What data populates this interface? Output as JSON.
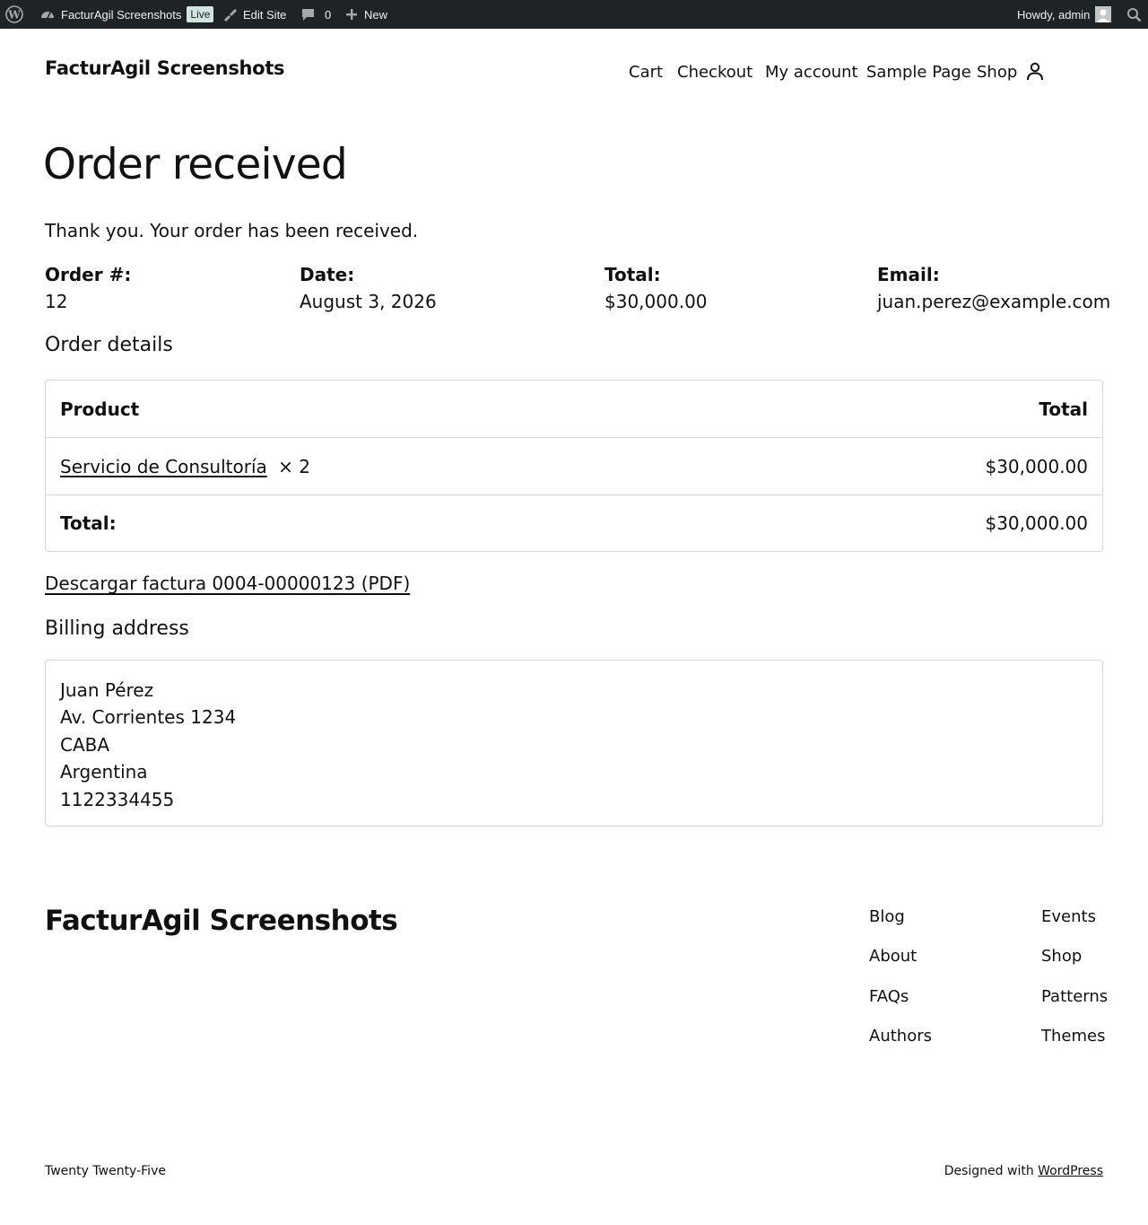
{
  "admin_bar": {
    "site_name": "FacturAgil Screenshots",
    "live_badge": "Live",
    "edit_site": "Edit Site",
    "comments_count": "0",
    "new_label": "New",
    "howdy": "Howdy, admin"
  },
  "header": {
    "site_title": "FacturAgil Screenshots",
    "nav": [
      "Cart",
      "Checkout",
      "My account",
      "Sample Page",
      "Shop"
    ]
  },
  "main": {
    "title": "Order received",
    "thank_you": "Thank you. Your order has been received.",
    "overview": [
      {
        "label": "Order #:",
        "value": "12"
      },
      {
        "label": "Date:",
        "value": "August 3, 2026"
      },
      {
        "label": "Total:",
        "value": "$30,000.00"
      },
      {
        "label": "Email:",
        "value": "juan.perez@example.com"
      }
    ],
    "order_details": {
      "heading": "Order details",
      "col_product": "Product",
      "col_total": "Total",
      "item_name": "Servicio de Consultoría",
      "item_qty": "× 2",
      "item_total": "$30,000.00",
      "total_label": "Total:",
      "total_value": "$30,000.00"
    },
    "invoice_link": "Descargar factura 0004-00000123 (PDF)",
    "billing": {
      "heading": "Billing address",
      "lines": [
        "Juan Pérez",
        "Av. Corrientes 1234",
        "CABA",
        "Argentina",
        "1122334455"
      ]
    }
  },
  "footer": {
    "site_title": "FacturAgil Screenshots",
    "col1": [
      "Blog",
      "About",
      "FAQs",
      "Authors"
    ],
    "col2": [
      "Events",
      "Shop",
      "Patterns",
      "Themes"
    ],
    "theme_name": "Twenty Twenty-Five",
    "designed_with": "Designed with",
    "wordpress_link": "WordPress"
  },
  "colors": {
    "admin_bar_bg": "#1d2327",
    "text": "#111111",
    "border": "#d5d5d5",
    "live_badge_bg": "#d1e4dd"
  }
}
